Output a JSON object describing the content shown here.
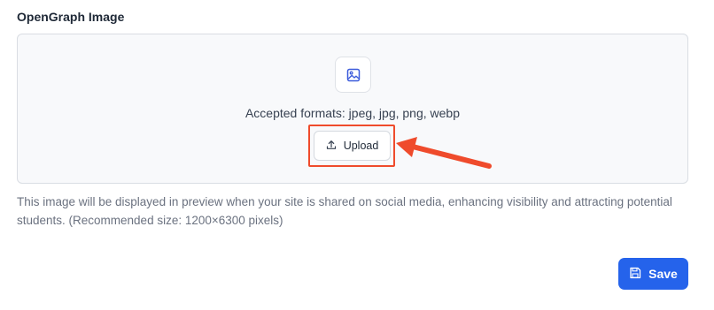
{
  "field": {
    "label": "OpenGraph Image"
  },
  "dropzone": {
    "icon": "image-icon",
    "formats_text": "Accepted formats: jpeg, jpg, png, webp",
    "upload_label": "Upload",
    "upload_icon": "upload-icon",
    "highlight_color": "#ef4b2c"
  },
  "help_text": "This image will be displayed in preview when your site is shared on social media, enhancing visibility and attracting potential students. (Recommended size: 1200×6300 pixels)",
  "save": {
    "label": "Save",
    "icon": "save-icon",
    "color": "#2563eb"
  }
}
